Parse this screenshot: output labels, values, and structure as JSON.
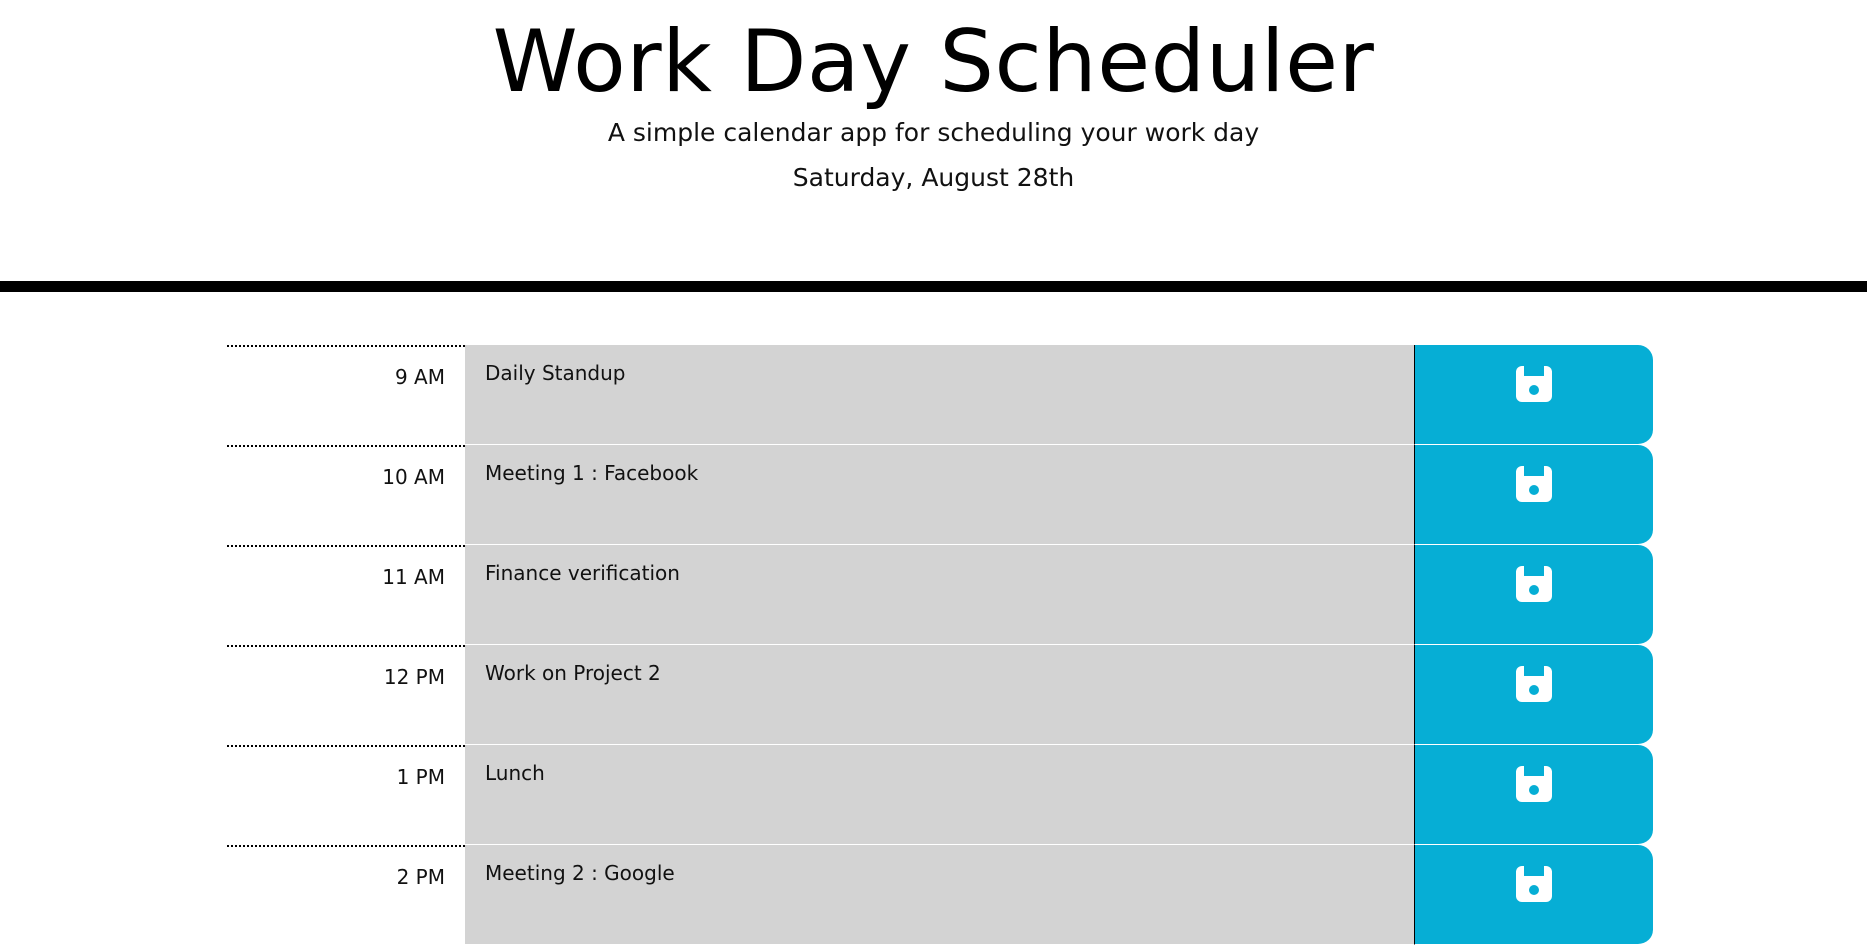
{
  "header": {
    "title": "Work Day Scheduler",
    "subtitle": "A simple calendar app for scheduling your work day",
    "current_day": "Saturday, August 28th"
  },
  "colors": {
    "past": "#d3d3d3",
    "save_button": "#06aed5",
    "divider": "#000000"
  },
  "timeblocks": [
    {
      "hour": "9 AM",
      "description": "Daily Standup",
      "icon": "save-icon"
    },
    {
      "hour": "10 AM",
      "description": "Meeting 1 : Facebook",
      "icon": "save-icon"
    },
    {
      "hour": "11 AM",
      "description": "Finance verification",
      "icon": "save-icon"
    },
    {
      "hour": "12 PM",
      "description": "Work on Project 2",
      "icon": "save-icon"
    },
    {
      "hour": "1 PM",
      "description": "Lunch",
      "icon": "save-icon"
    },
    {
      "hour": "2 PM",
      "description": "Meeting 2 : Google",
      "icon": "save-icon"
    }
  ]
}
